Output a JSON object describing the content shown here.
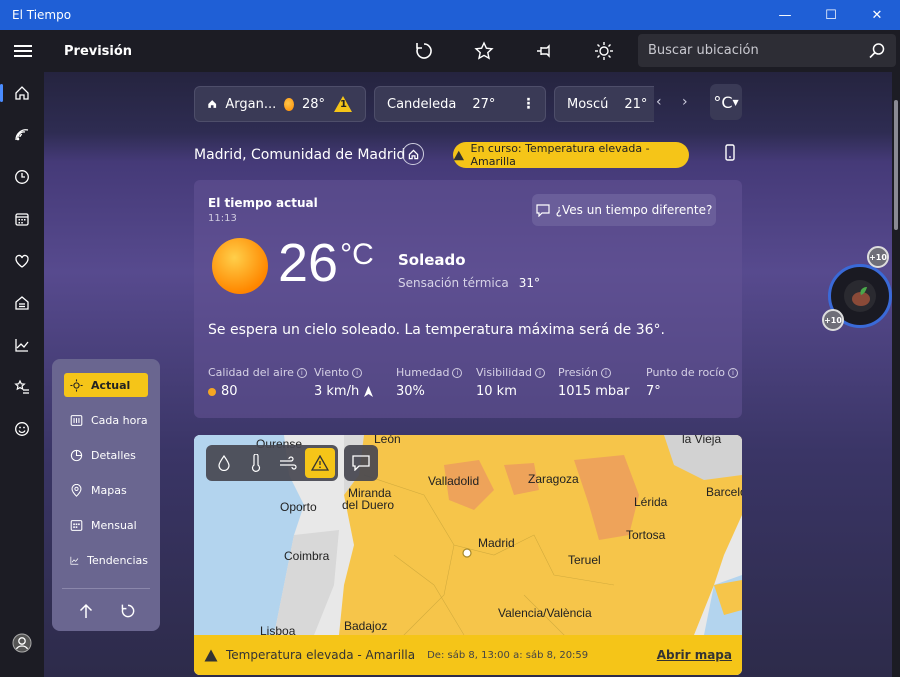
{
  "window": {
    "title": "El Tiempo",
    "minimize": "—",
    "maximize": "☐",
    "close": "✕"
  },
  "toolbar": {
    "app_title": "Previsión",
    "search_placeholder": "Buscar ubicación"
  },
  "locations": [
    {
      "name": "Argan...",
      "temp": "28°",
      "alert": "1"
    },
    {
      "name": "Candeleda",
      "temp": "27°"
    },
    {
      "name": "Moscú",
      "temp": "21°"
    }
  ],
  "unit_toggle": "°C",
  "location_header": {
    "title": "Madrid, Comunidad de Madrid",
    "alert_pill": "En curso: Temperatura elevada - Amarilla"
  },
  "current": {
    "heading": "El tiempo actual",
    "time": "11:13",
    "different_weather_btn": "¿Ves un tiempo diferente?",
    "temperature": "26",
    "unit": "°C",
    "condition": "Soleado",
    "feels_like_label": "Sensación térmica",
    "feels_like_value": "31°",
    "description": "Se espera un cielo soleado. La temperatura máxima será de 36°.",
    "stats": [
      {
        "label": "Calidad del aire",
        "value": "80"
      },
      {
        "label": "Viento",
        "value": "3 km/h"
      },
      {
        "label": "Humedad",
        "value": "30%"
      },
      {
        "label": "Visibilidad",
        "value": "10 km"
      },
      {
        "label": "Presión",
        "value": "1015 mbar"
      },
      {
        "label": "Punto de rocío",
        "value": "7°"
      }
    ]
  },
  "map": {
    "cities": [
      "Ourense",
      "León",
      "Valladolid",
      "Zaragoza",
      "Lérida",
      "Barcelo",
      "Miranda",
      "del Duero",
      "Oporto",
      "Coimbra",
      "Madrid",
      "Tortosa",
      "Teruel",
      "Badajoz",
      "Valencia/València",
      "Lisboa",
      "la Vieja"
    ],
    "banner_text": "Temperatura elevada - Amarilla",
    "banner_dates": "De: sáb 8, 13:00 a: sáb 8, 20:59",
    "banner_link": "Abrir mapa"
  },
  "side_menu": [
    "Actual",
    "Cada hora",
    "Detalles",
    "Mapas",
    "Mensual",
    "Tendencias"
  ],
  "rewards": {
    "badge_top": "+10",
    "badge_bottom": "+10"
  },
  "colors": {
    "accent_yellow": "#f5c518",
    "titlebar_blue": "#1f5fd6",
    "aqi_dot": "#f5a623"
  }
}
